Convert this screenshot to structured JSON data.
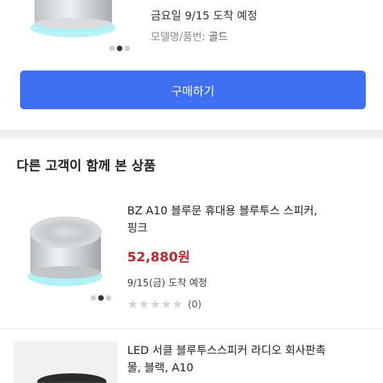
{
  "top_product": {
    "delivery": "금요일 9/15 도착 예정",
    "model_label": "모델명/품번: ",
    "model_value": "골드",
    "buy_button": "구매하기"
  },
  "section": {
    "title": "다른 고객이 함께 본 상품"
  },
  "products": [
    {
      "title_line1": "BZ A10 블루문 휴대용 블루투스 스피커,",
      "title_line2": "핑크",
      "price": "52,880원",
      "delivery": "9/15(금) 도착 예정",
      "stars": "★★★★★",
      "rating_stars": 0,
      "review_count": "(0)"
    },
    {
      "title_line1": "LED 서클 블루투스스피커 라디오 회사판촉",
      "title_line2": "물, 블랙, A10"
    }
  ],
  "icons": {
    "star": "star-icon",
    "dot": "carousel-dot-icon"
  },
  "colors": {
    "buy_button": "#3e6ff0",
    "price": "#c0262f"
  }
}
